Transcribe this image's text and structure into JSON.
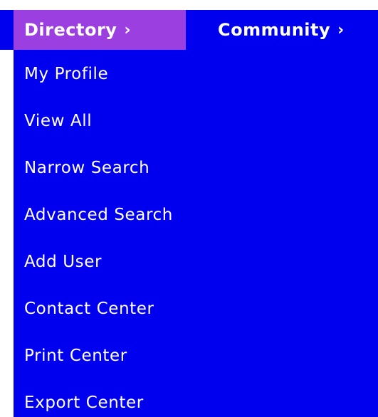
{
  "nav": {
    "tabs": [
      {
        "label": "Directory",
        "chevron": "›",
        "active": true
      },
      {
        "label": "Community",
        "chevron": "›",
        "active": false
      }
    ]
  },
  "menu": {
    "items": [
      {
        "label": "My Profile"
      },
      {
        "label": "View All"
      },
      {
        "label": "Narrow Search"
      },
      {
        "label": "Advanced Search"
      },
      {
        "label": "Add User"
      },
      {
        "label": "Contact Center"
      },
      {
        "label": "Print Center"
      },
      {
        "label": "Export Center"
      }
    ]
  },
  "colors": {
    "menu_background": "#0000ee",
    "active_tab": "#9b3fe0",
    "text": "#ffffff"
  }
}
